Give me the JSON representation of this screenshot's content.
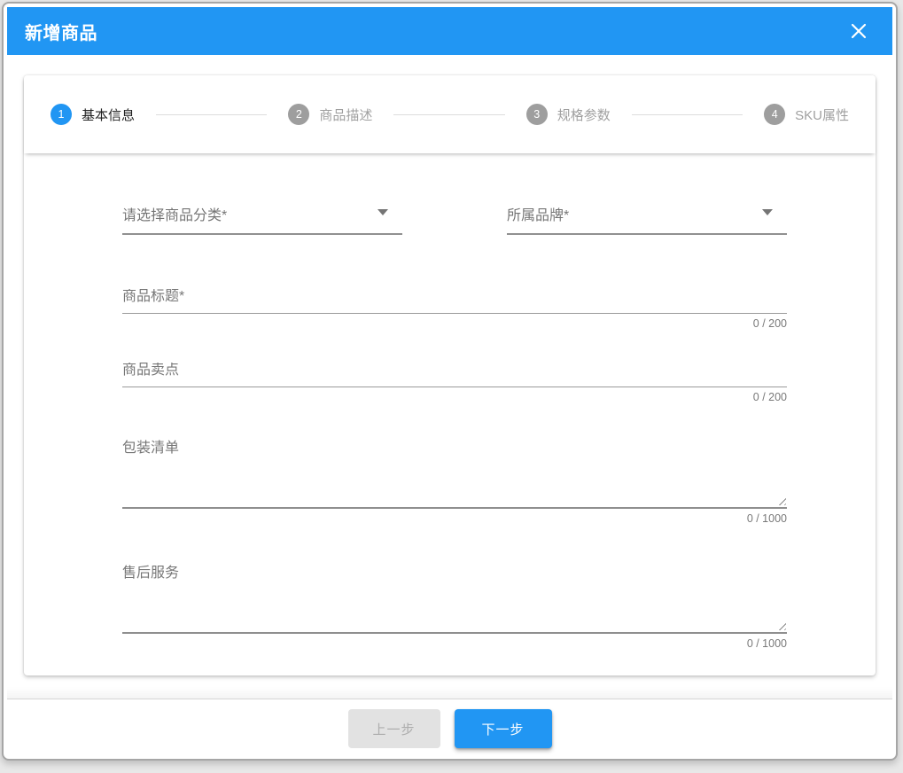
{
  "dialog": {
    "title": "新增商品"
  },
  "stepper": {
    "steps": [
      {
        "number": "1",
        "label": "基本信息",
        "active": true
      },
      {
        "number": "2",
        "label": "商品描述",
        "active": false
      },
      {
        "number": "3",
        "label": "规格参数",
        "active": false
      },
      {
        "number": "4",
        "label": "SKU属性",
        "active": false
      }
    ]
  },
  "form": {
    "category_select": {
      "placeholder": "请选择商品分类*",
      "value": ""
    },
    "brand_select": {
      "placeholder": "所属品牌*",
      "value": ""
    },
    "title_field": {
      "placeholder": "商品标题*",
      "value": "",
      "counter": "0 / 200"
    },
    "selling_point_field": {
      "placeholder": "商品卖点",
      "value": "",
      "counter": "0 / 200"
    },
    "packing_list_field": {
      "placeholder": "包装清单",
      "value": "",
      "counter": "0 / 1000"
    },
    "after_sales_field": {
      "placeholder": "售后服务",
      "value": "",
      "counter": "0 / 1000"
    }
  },
  "actions": {
    "previous_label": "上一步",
    "next_label": "下一步"
  },
  "icons": {
    "close": "close-icon",
    "dropdown": "dropdown-arrow-icon",
    "resize": "resize-handle-icon"
  },
  "colors": {
    "primary": "#2196f3",
    "step_inactive": "#9e9e9e",
    "disabled_button_bg": "#e2e2e2",
    "disabled_button_text": "#adadad"
  }
}
